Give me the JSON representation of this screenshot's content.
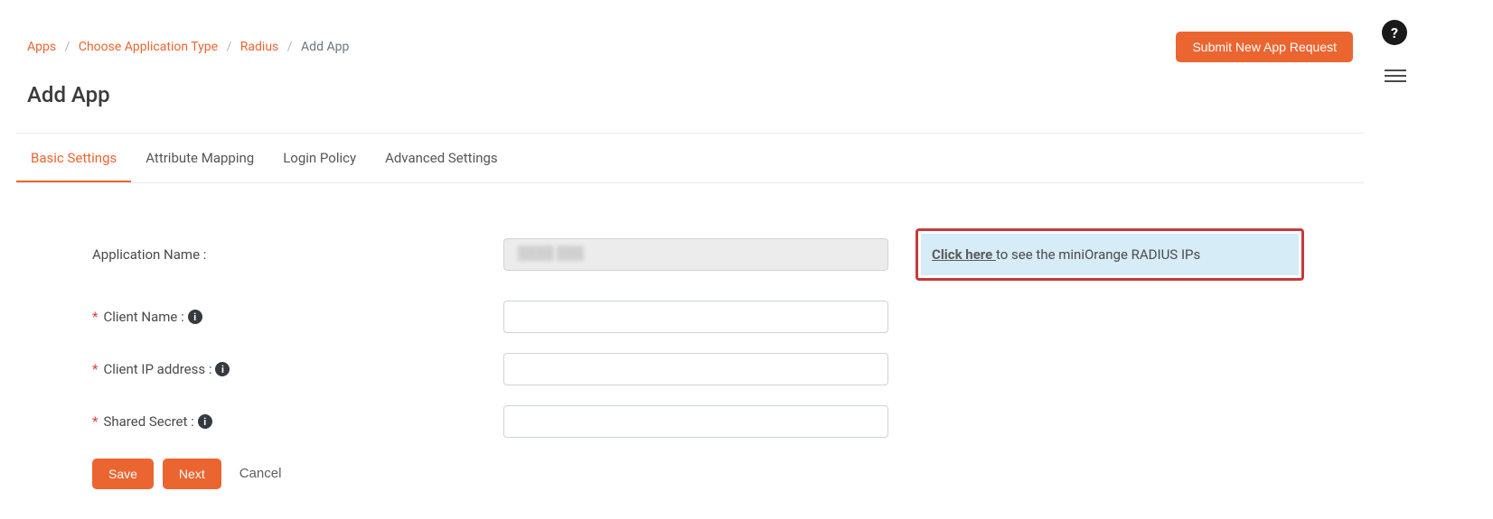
{
  "breadcrumbs": {
    "items": [
      {
        "label": "Apps"
      },
      {
        "label": "Choose Application Type"
      },
      {
        "label": "Radius"
      }
    ],
    "current": "Add App"
  },
  "topButton": "Submit New App Request",
  "pageTitle": "Add App",
  "tabs": [
    {
      "label": "Basic Settings",
      "active": true
    },
    {
      "label": "Attribute Mapping",
      "active": false
    },
    {
      "label": "Login Policy",
      "active": false
    },
    {
      "label": "Advanced Settings",
      "active": false
    }
  ],
  "fields": {
    "appName": {
      "label": "Application Name :",
      "value": ""
    },
    "clientName": {
      "label": "Client Name :",
      "value": ""
    },
    "clientIp": {
      "label": "Client IP address :",
      "value": ""
    },
    "sharedSecret": {
      "label": "Shared Secret :",
      "value": ""
    }
  },
  "infoBox": {
    "linkText": "Click here ",
    "rest": "to see the miniOrange RADIUS IPs"
  },
  "buttons": {
    "save": "Save",
    "next": "Next",
    "cancel": "Cancel"
  },
  "infoGlyph": "i",
  "helpGlyph": "?"
}
